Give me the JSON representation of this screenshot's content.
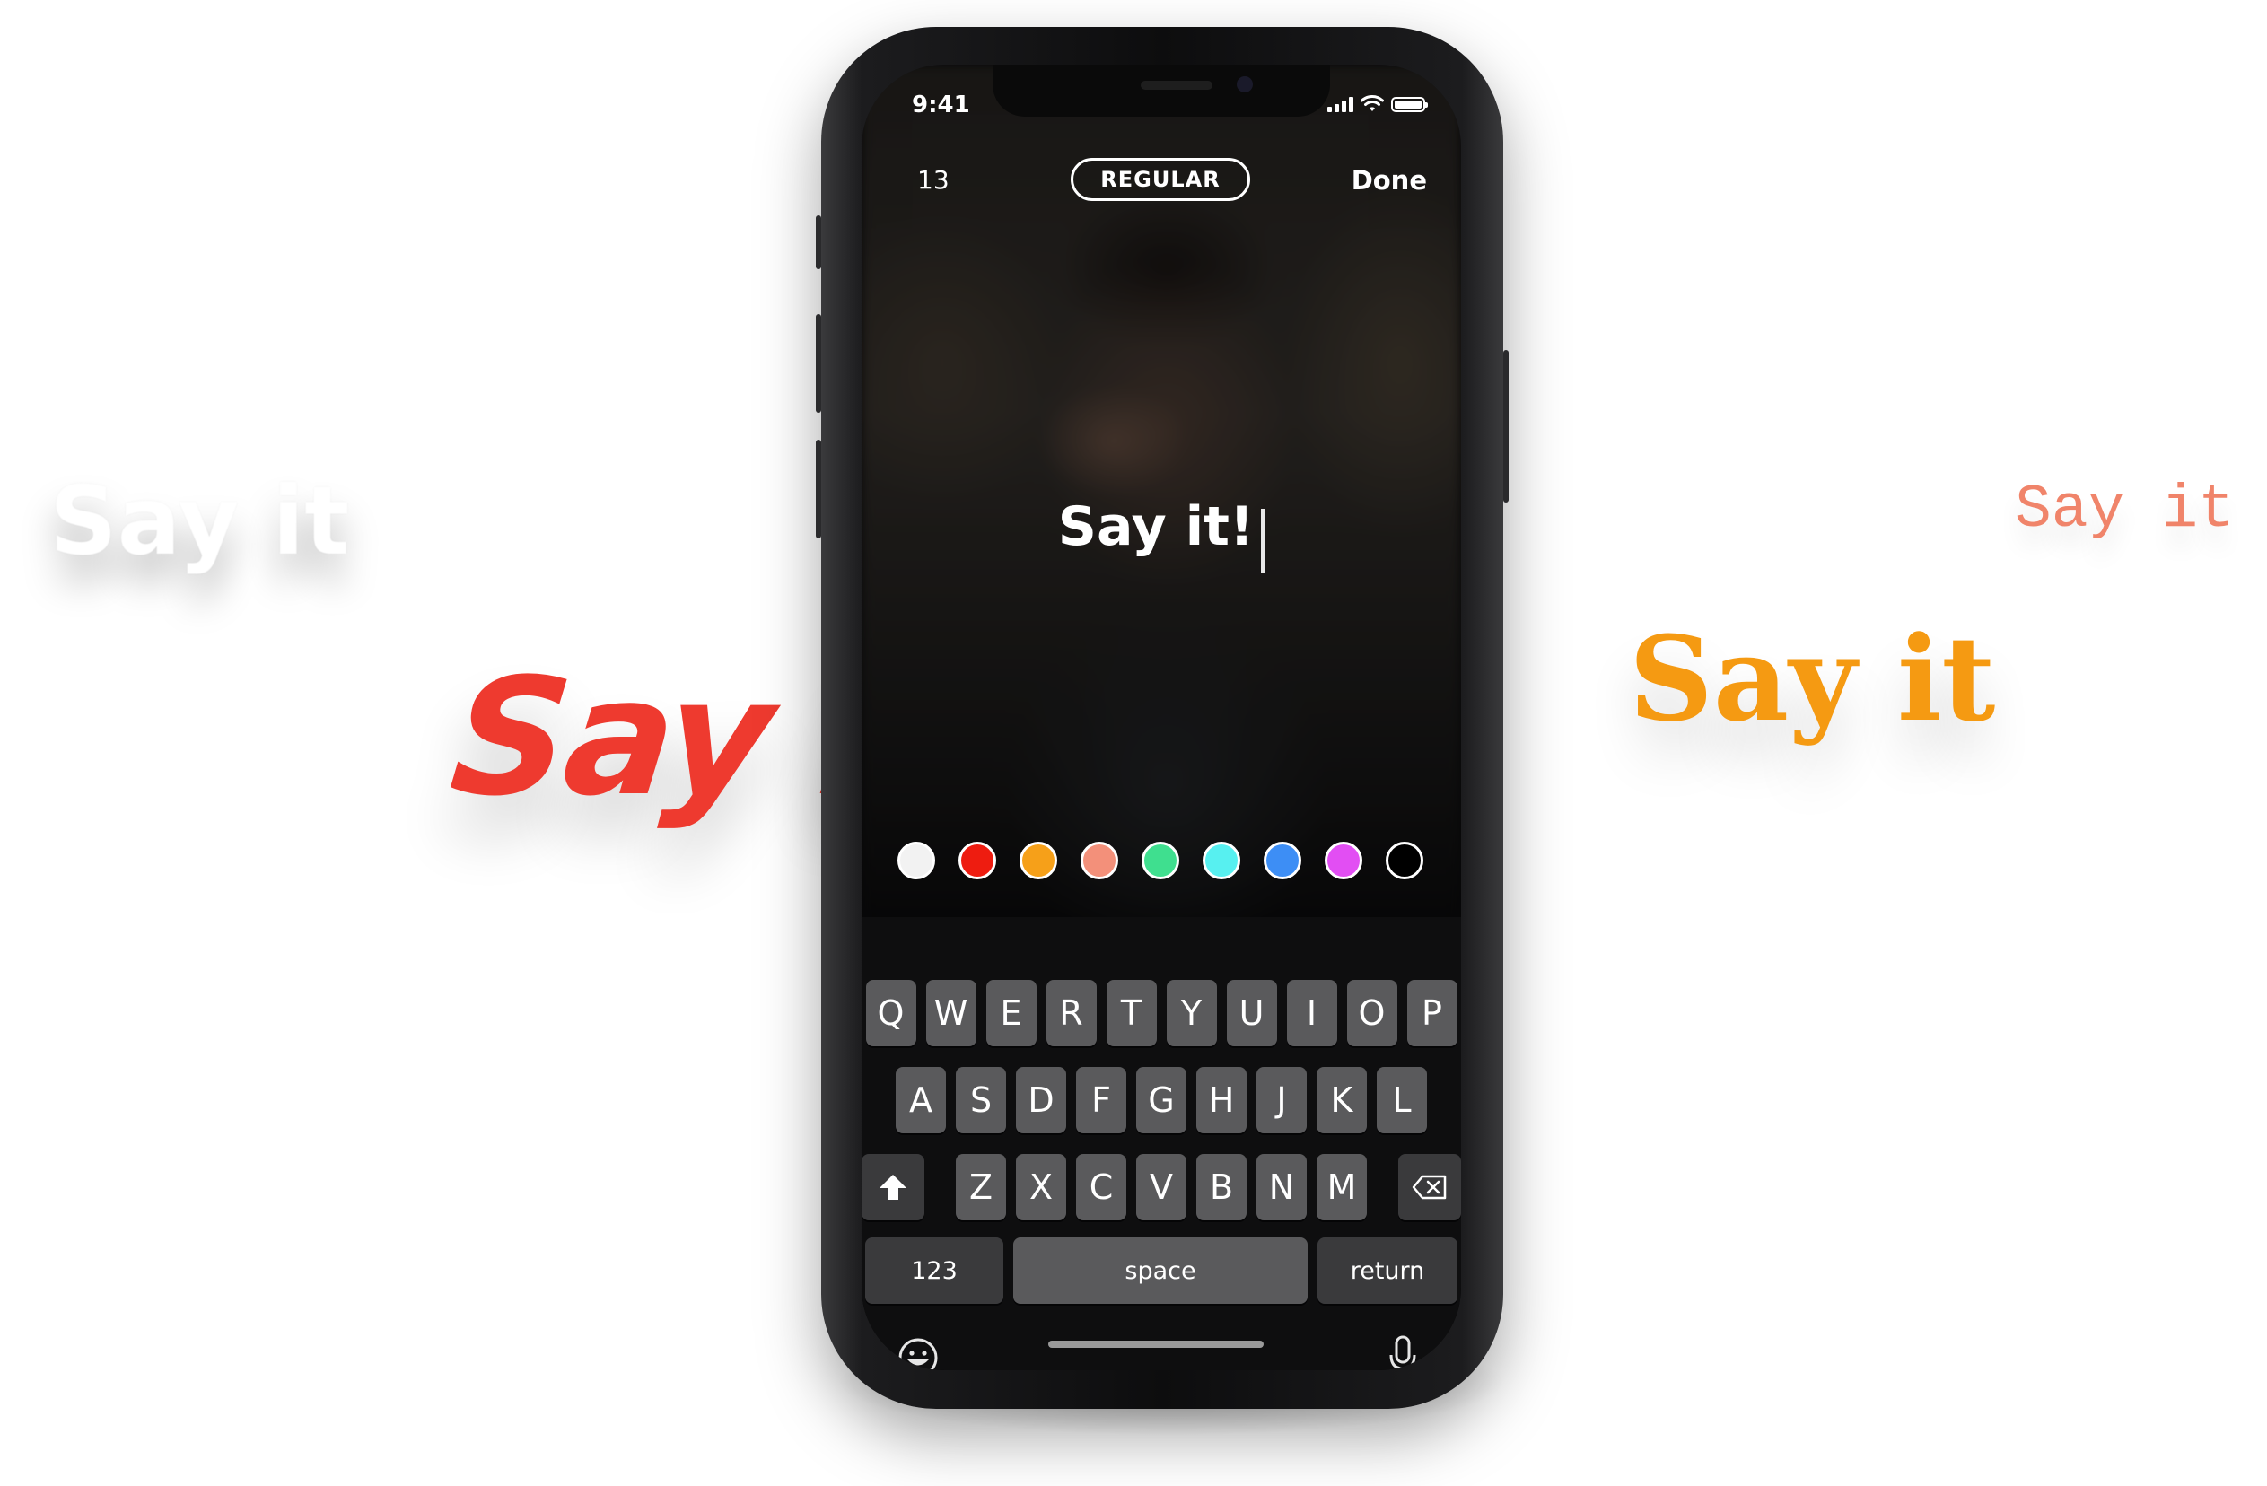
{
  "samples": {
    "white": {
      "text": "Say it",
      "color": "#ffffff"
    },
    "red": {
      "text": "Say it",
      "color": "#ee3a2f"
    },
    "orange": {
      "text": "Say it",
      "color": "#f59a12"
    },
    "mono": {
      "text": "Say it",
      "color": "#f0846a"
    }
  },
  "status_bar": {
    "time": "9:41",
    "battery_level": 1.0
  },
  "editor": {
    "char_count": "13",
    "style_label": "REGULAR",
    "done_label": "Done",
    "caption": "Say it!"
  },
  "colors": [
    {
      "name": "white",
      "hex": "#f2f2f2"
    },
    {
      "name": "red",
      "hex": "#ee1c10"
    },
    {
      "name": "orange",
      "hex": "#f6a019"
    },
    {
      "name": "salmon",
      "hex": "#f3907a"
    },
    {
      "name": "green",
      "hex": "#3fdf8f"
    },
    {
      "name": "cyan",
      "hex": "#57f0f0"
    },
    {
      "name": "blue",
      "hex": "#3d8ef5"
    },
    {
      "name": "magenta",
      "hex": "#e24ef3"
    },
    {
      "name": "black",
      "hex": "#000000"
    }
  ],
  "keyboard": {
    "row1": [
      "Q",
      "W",
      "E",
      "R",
      "T",
      "Y",
      "U",
      "I",
      "O",
      "P"
    ],
    "row2": [
      "A",
      "S",
      "D",
      "F",
      "G",
      "H",
      "J",
      "K",
      "L"
    ],
    "row3": [
      "Z",
      "X",
      "C",
      "V",
      "B",
      "N",
      "M"
    ],
    "numbers_label": "123",
    "space_label": "space",
    "return_label": "return"
  }
}
